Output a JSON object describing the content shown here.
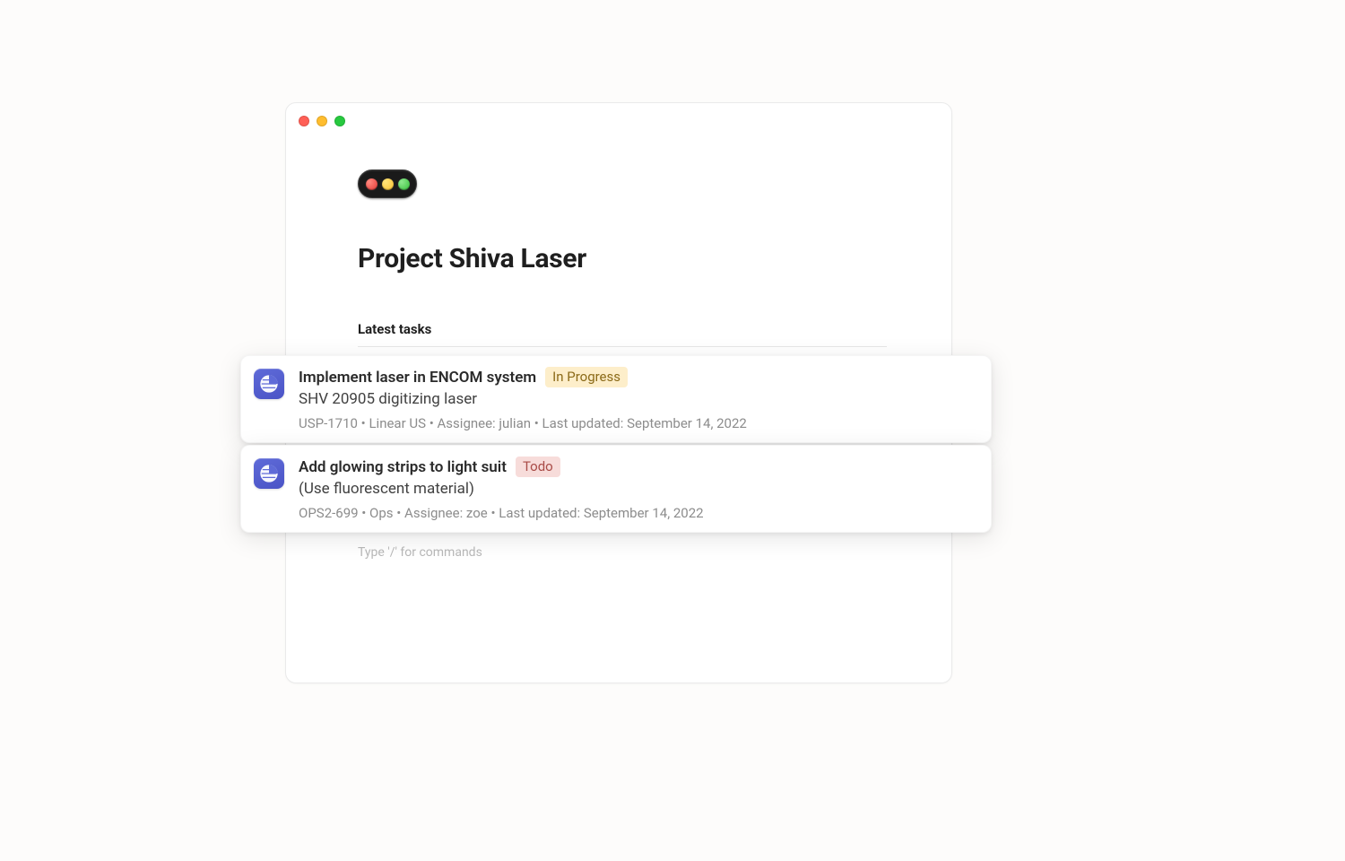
{
  "page": {
    "title": "Project Shiva Laser",
    "section_title": "Latest tasks",
    "placeholder": "Type '/' for commands"
  },
  "tasks": [
    {
      "title": "Implement laser in ENCOM system",
      "status": {
        "label": "In Progress",
        "kind": "in-progress"
      },
      "subtitle": "SHV 20905 digitizing laser",
      "meta": "USP-1710 • Linear US • Assignee: julian • Last updated: September 14, 2022",
      "icon": "linear-icon"
    },
    {
      "title": "Add glowing strips to light suit",
      "status": {
        "label": "Todo",
        "kind": "todo"
      },
      "subtitle": "(Use fluorescent material)",
      "meta": "OPS2-699 • Ops • Assignee: zoe • Last updated: September 14, 2022",
      "icon": "linear-icon"
    }
  ]
}
